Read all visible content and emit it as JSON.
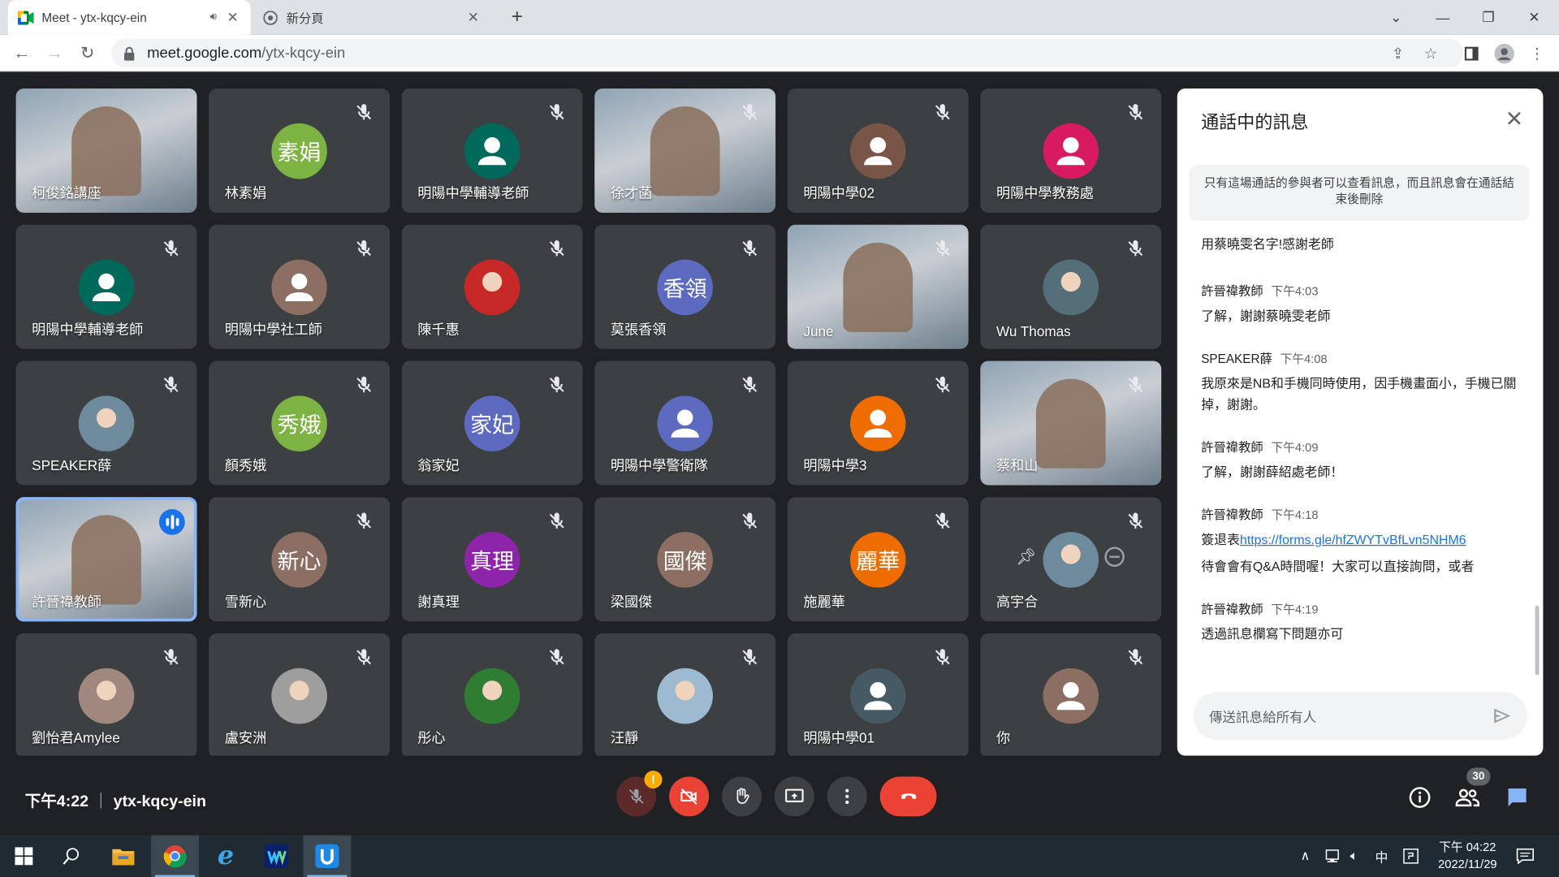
{
  "browser": {
    "tabs": [
      {
        "label": "Meet - ytx-kqcy-ein",
        "active": true
      },
      {
        "label": "新分頁",
        "active": false
      }
    ],
    "url_host": "meet.google.com",
    "url_path": "/ytx-kqcy-ein"
  },
  "participants": [
    {
      "name": "柯俊銘講座",
      "avatar": "video",
      "muted": false
    },
    {
      "name": "林素娟",
      "avatar": "素娟",
      "color": "#7cb342",
      "muted": true
    },
    {
      "name": "明陽中學輔導老師",
      "avatar": "person",
      "color": "#00695c",
      "muted": true
    },
    {
      "name": "徐才菡",
      "avatar": "video",
      "muted": true
    },
    {
      "name": "明陽中學02",
      "avatar": "person",
      "color": "#795548",
      "muted": true
    },
    {
      "name": "明陽中學教務處",
      "avatar": "person",
      "color": "#d81b60",
      "muted": true
    },
    {
      "name": "明陽中學輔導老師",
      "avatar": "person",
      "color": "#00695c",
      "muted": true
    },
    {
      "name": "明陽中學社工師",
      "avatar": "person",
      "color": "#8d6e63",
      "muted": true
    },
    {
      "name": "陳千惠",
      "avatar": "photo",
      "color": "#c62828",
      "muted": true
    },
    {
      "name": "莫張香領",
      "avatar": "香領",
      "color": "#5c6bc0",
      "muted": true
    },
    {
      "name": "June",
      "avatar": "video",
      "muted": true
    },
    {
      "name": "Wu Thomas",
      "avatar": "photo",
      "color": "#546e7a",
      "muted": true
    },
    {
      "name": "SPEAKER薛",
      "avatar": "photo",
      "color": "#6d8b9c",
      "muted": true
    },
    {
      "name": "顏秀娥",
      "avatar": "秀娥",
      "color": "#7cb342",
      "muted": true
    },
    {
      "name": "翁家妃",
      "avatar": "家妃",
      "color": "#5c6bc0",
      "muted": true
    },
    {
      "name": "明陽中學警衛隊",
      "avatar": "person",
      "color": "#5c6bc0",
      "muted": true
    },
    {
      "name": "明陽中學3",
      "avatar": "person",
      "color": "#ef6c00",
      "muted": true
    },
    {
      "name": "蔡和山",
      "avatar": "video",
      "muted": true
    },
    {
      "name": "許晉禕教師",
      "avatar": "video",
      "muted": false,
      "speaking": true
    },
    {
      "name": "雪新心",
      "avatar": "新心",
      "color": "#8d6e63",
      "muted": true
    },
    {
      "name": "謝真理",
      "avatar": "真理",
      "color": "#8e24aa",
      "muted": true
    },
    {
      "name": "梁國傑",
      "avatar": "國傑",
      "color": "#8d6e63",
      "muted": true
    },
    {
      "name": "施麗華",
      "avatar": "麗華",
      "color": "#ef6c00",
      "muted": true
    },
    {
      "name": "高宇合",
      "avatar": "photo",
      "color": "#6d8b9c",
      "muted": true,
      "pinned": true
    },
    {
      "name": "劉怡君Amylee",
      "avatar": "photo",
      "color": "#a1887f",
      "muted": true
    },
    {
      "name": "盧安洲",
      "avatar": "photo",
      "color": "#9e9e9e",
      "muted": true
    },
    {
      "name": "彤心",
      "avatar": "photo",
      "color": "#2e7d32",
      "muted": true
    },
    {
      "name": "汪靜",
      "avatar": "photo",
      "color": "#9ebad0",
      "muted": true
    },
    {
      "name": "明陽中學01",
      "avatar": "person",
      "color": "#455a64",
      "muted": true
    },
    {
      "name": "你",
      "avatar": "person",
      "color": "#8d6e63",
      "muted": true
    }
  ],
  "chat": {
    "title": "通話中的訊息",
    "notice": "只有這場通話的參與者可以查看訊息，而且訊息會在通話結束後刪除",
    "first_line": "用蔡曉雯名字!感謝老師",
    "messages": [
      {
        "sender": "許晉禕教師",
        "time": "下午4:03",
        "lines": [
          "了解，謝謝蔡曉雯老師"
        ]
      },
      {
        "sender": "SPEAKER薛",
        "time": "下午4:08",
        "lines": [
          "我原來是NB和手機同時使用，因手機畫面小，手機已關掉，謝謝。"
        ]
      },
      {
        "sender": "許晉禕教師",
        "time": "下午4:09",
        "lines": [
          "了解，謝謝薛紹處老師！"
        ]
      },
      {
        "sender": "許晉禕教師",
        "time": "下午4:18",
        "lines": [
          "簽退表"
        ],
        "link": "https://forms.gle/hfZWYTvBfLvn5NHM6",
        "extra": "待會會有Q&A時間喔！大家可以直接詢問，或者"
      },
      {
        "sender": "許晉禕教師",
        "time": "下午4:19",
        "lines": [
          "透過訊息欄寫下問題亦可"
        ]
      }
    ],
    "input_placeholder": "傳送訊息給所有人"
  },
  "meeting": {
    "time": "下午4:22",
    "code": "ytx-kqcy-ein",
    "participant_count": "30"
  },
  "taskbar": {
    "clock_time": "下午 04:22",
    "clock_date": "2022/11/29",
    "ime": "中"
  },
  "colors": {
    "meet_bg": "#202124",
    "tile_bg": "#3c4043",
    "end_call": "#ea4335",
    "chat_icon": "#8ab4f8"
  }
}
